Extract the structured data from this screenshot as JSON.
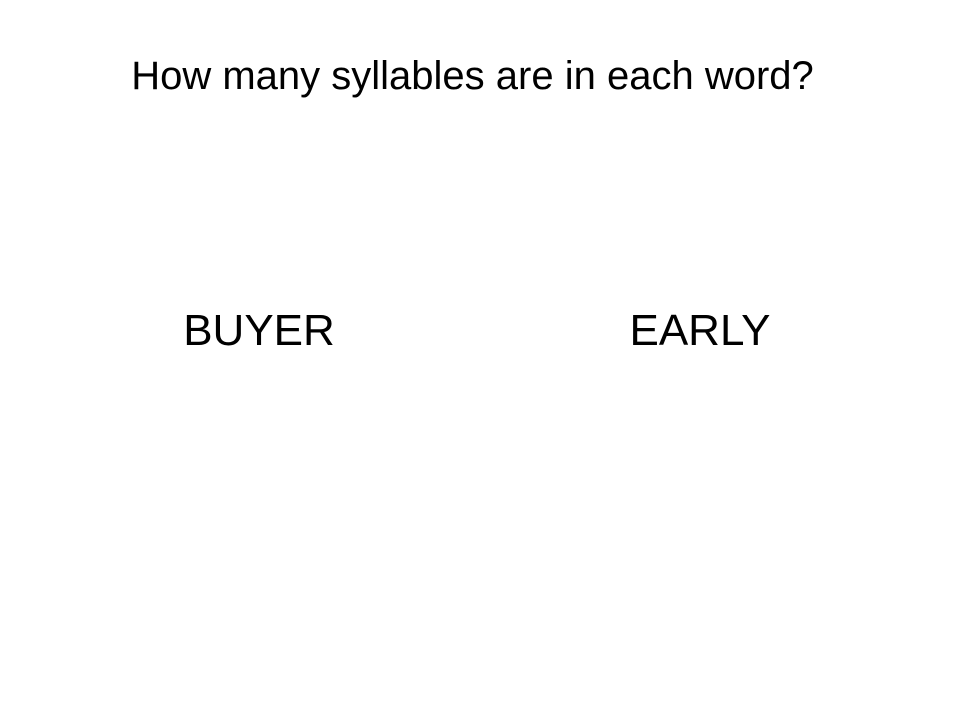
{
  "slide": {
    "title": "How many syllables are in each word?",
    "words": [
      "BUYER",
      "EARLY"
    ]
  }
}
